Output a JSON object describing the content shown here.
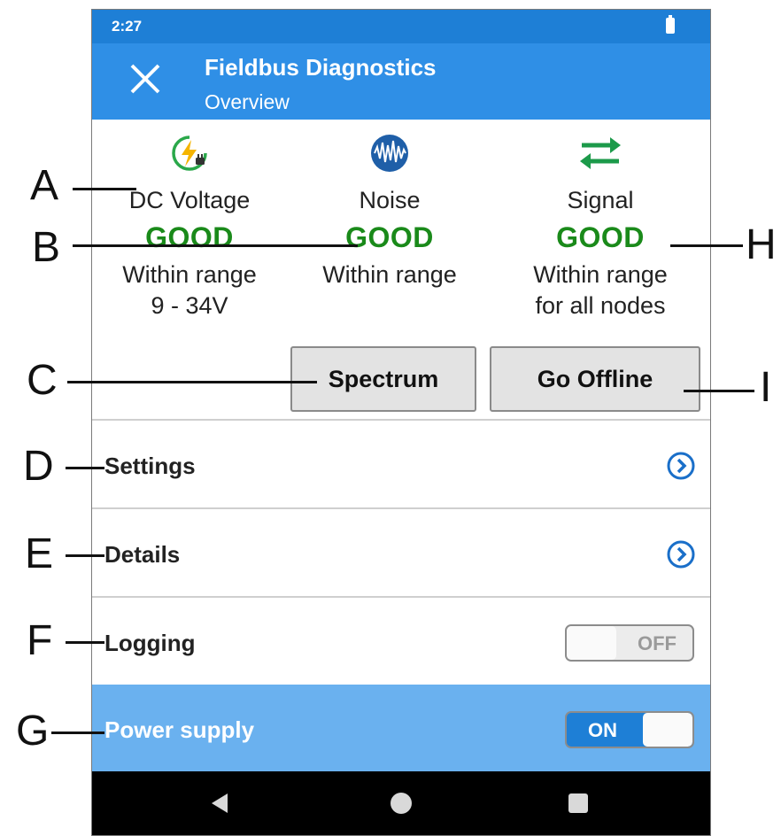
{
  "statusbar": {
    "time": "2:27"
  },
  "appbar": {
    "title": "Fieldbus Diagnostics",
    "subtitle": "Overview"
  },
  "status": [
    {
      "icon": "dc-voltage-icon",
      "label": "DC Voltage",
      "value": "GOOD",
      "desc1": "Within range",
      "desc2": "9 - 34V"
    },
    {
      "icon": "noise-waveform-icon",
      "label": "Noise",
      "value": "GOOD",
      "desc1": "Within range",
      "desc2": ""
    },
    {
      "icon": "signal-arrows-icon",
      "label": "Signal",
      "value": "GOOD",
      "desc1": "Within range",
      "desc2": "for all nodes"
    }
  ],
  "buttons": {
    "spectrum": "Spectrum",
    "go_offline": "Go Offline"
  },
  "menu": {
    "settings": "Settings",
    "details": "Details",
    "logging": {
      "label": "Logging",
      "state": "OFF"
    },
    "power_supply": {
      "label": "Power supply",
      "state": "ON"
    }
  },
  "callouts": [
    "A",
    "B",
    "C",
    "D",
    "E",
    "F",
    "G",
    "H",
    "I"
  ],
  "colors": {
    "appbar": "#2f8fe6",
    "statusbar": "#1e7fd6",
    "good": "#1a8a1a",
    "power_row": "#6ab1ef",
    "chevron": "#1a6fc9"
  }
}
